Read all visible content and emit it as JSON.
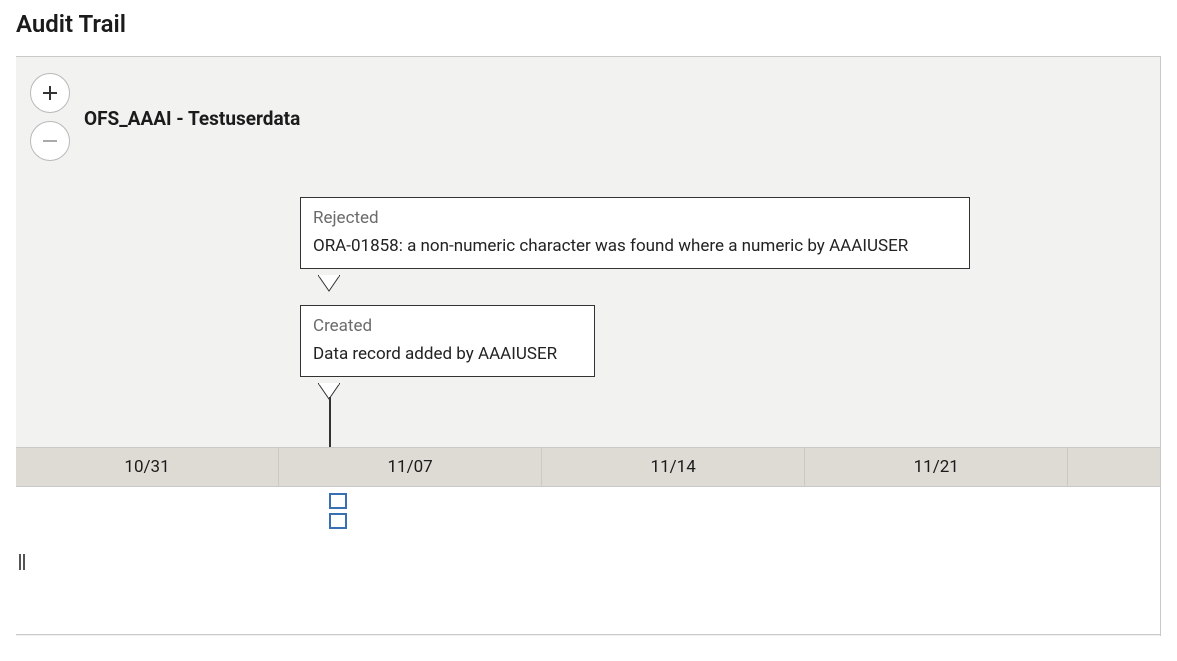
{
  "page": {
    "title": "Audit Trail"
  },
  "header": {
    "title": "OFS_AAAI - Testuserdata"
  },
  "controls": {
    "zoom_in_label": "+",
    "zoom_out_label": "−"
  },
  "timeline": {
    "ticks": [
      "10/31",
      "11/07",
      "11/14",
      "11/21"
    ]
  },
  "events": [
    {
      "status": "Rejected",
      "message": "ORA-01858: a non-numeric character was found where a numeric by AAAIUSER"
    },
    {
      "status": "Created",
      "message": "Data record added by AAAIUSER"
    }
  ]
}
